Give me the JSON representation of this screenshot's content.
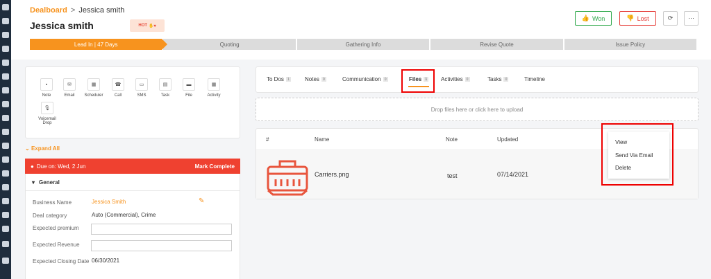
{
  "breadcrumb": {
    "root": "Dealboard",
    "separator": ">",
    "current": "Jessica smith"
  },
  "page_title": "Jessica smith",
  "priority_badge": "HOT",
  "header_buttons": {
    "won": "Won",
    "lost": "Lost",
    "refresh_icon": "refresh-icon",
    "more_icon": "more-icon"
  },
  "stages": [
    "Lead In | 47 Days",
    "Quoting",
    "Gathering Info",
    "Revise Quote",
    "Issue Policy"
  ],
  "actions": [
    "Note",
    "Email",
    "Scheduler",
    "Call",
    "SMS",
    "Task",
    "File",
    "Activity",
    "Voicemail Drop"
  ],
  "expand_all": "Expand All",
  "due_bar": {
    "text": "Due on: Wed, 2 Jun",
    "action": "Mark Complete"
  },
  "general": {
    "heading": "General",
    "fields": [
      {
        "label": "Business Name",
        "value": "Jessica Smith"
      },
      {
        "label": "Deal category",
        "value": "Auto (Commercial), Crime"
      },
      {
        "label": "Expected premium",
        "value": ""
      },
      {
        "label": "Expected Revenue",
        "value": ""
      },
      {
        "label": "Expected Closing Date",
        "value": "06/30/2021"
      }
    ]
  },
  "tabs": [
    {
      "label": "To Dos",
      "count": "1"
    },
    {
      "label": "Notes",
      "count": "0"
    },
    {
      "label": "Communication",
      "count": "0"
    },
    {
      "label": "Files",
      "count": "1"
    },
    {
      "label": "Activities",
      "count": "0"
    },
    {
      "label": "Tasks",
      "count": "0"
    },
    {
      "label": "Timeline",
      "count": ""
    }
  ],
  "dropzone": "Drop files here or click here to upload",
  "files_table": {
    "headers": [
      "#",
      "Name",
      "Note",
      "Updated"
    ],
    "rows": [
      {
        "name": "Carriers.png",
        "note": "test",
        "updated": "07/14/2021"
      }
    ]
  },
  "context_menu": [
    "View",
    "Send Via Email",
    "Delete"
  ],
  "colors": {
    "accent": "#f7931e",
    "danger": "#ef4130",
    "success": "#2ea84a"
  }
}
